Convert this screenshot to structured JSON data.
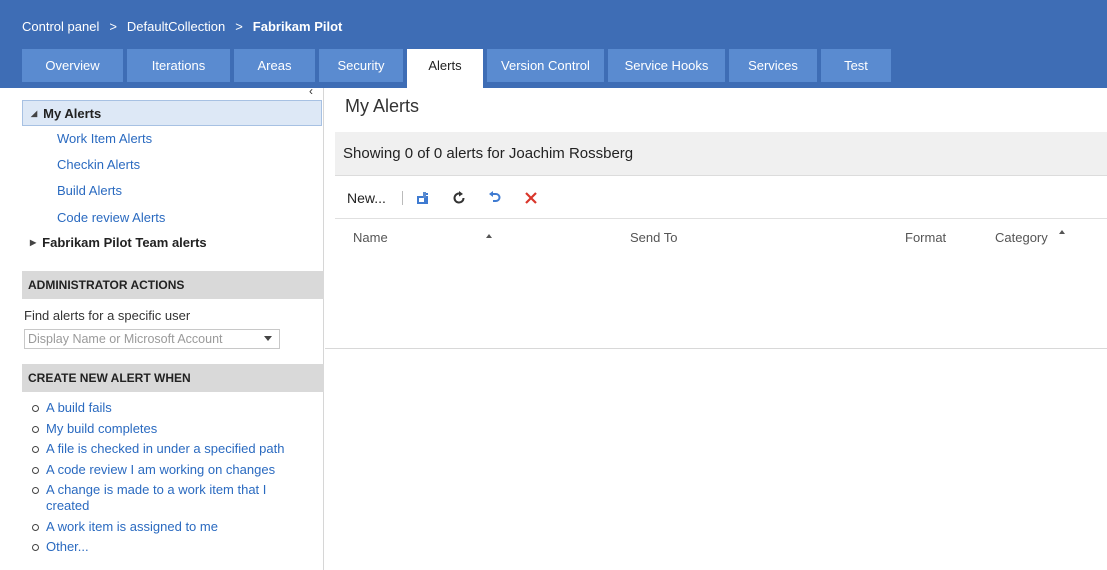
{
  "breadcrumb": {
    "items": [
      "Control panel",
      "DefaultCollection",
      "Fabrikam Pilot"
    ],
    "separator": ">"
  },
  "tabs": [
    {
      "label": "Overview",
      "active": false
    },
    {
      "label": "Iterations",
      "active": false
    },
    {
      "label": "Areas",
      "active": false
    },
    {
      "label": "Security",
      "active": false
    },
    {
      "label": "Alerts",
      "active": true
    },
    {
      "label": "Version Control",
      "active": false
    },
    {
      "label": "Service Hooks",
      "active": false
    },
    {
      "label": "Services",
      "active": false
    },
    {
      "label": "Test",
      "active": false
    }
  ],
  "sidebar": {
    "collapse_glyph": "‹",
    "my_alerts": {
      "label": "My Alerts",
      "items": [
        "Work Item Alerts",
        "Checkin Alerts",
        "Build Alerts",
        "Code review Alerts"
      ]
    },
    "team_alerts_label": "Fabrikam Pilot Team alerts",
    "admin_header": "ADMINISTRATOR ACTIONS",
    "find_label": "Find alerts for a specific user",
    "user_select_placeholder": "Display Name or Microsoft Account",
    "create_header": "CREATE NEW ALERT WHEN",
    "create_items": [
      "A build fails",
      "My build completes",
      "A file is checked in under a specified path",
      "A code review I am working on changes",
      "A change is made to a work item that I created",
      "A work item is assigned to me",
      "Other..."
    ]
  },
  "main": {
    "title": "My Alerts",
    "summary": "Showing 0 of 0 alerts for Joachim Rossberg",
    "toolbar": {
      "new_label": "New...",
      "icons": [
        "save-icon",
        "refresh-icon",
        "undo-icon",
        "delete-icon"
      ]
    },
    "columns": [
      "Name",
      "Send To",
      "Format",
      "Category"
    ]
  },
  "colors": {
    "header_bg": "#3e6db5",
    "tab_bg": "#5a8bd0",
    "link": "#2a6ac0",
    "selected_bg": "#dde8f6",
    "delete_red": "#d9362b"
  }
}
